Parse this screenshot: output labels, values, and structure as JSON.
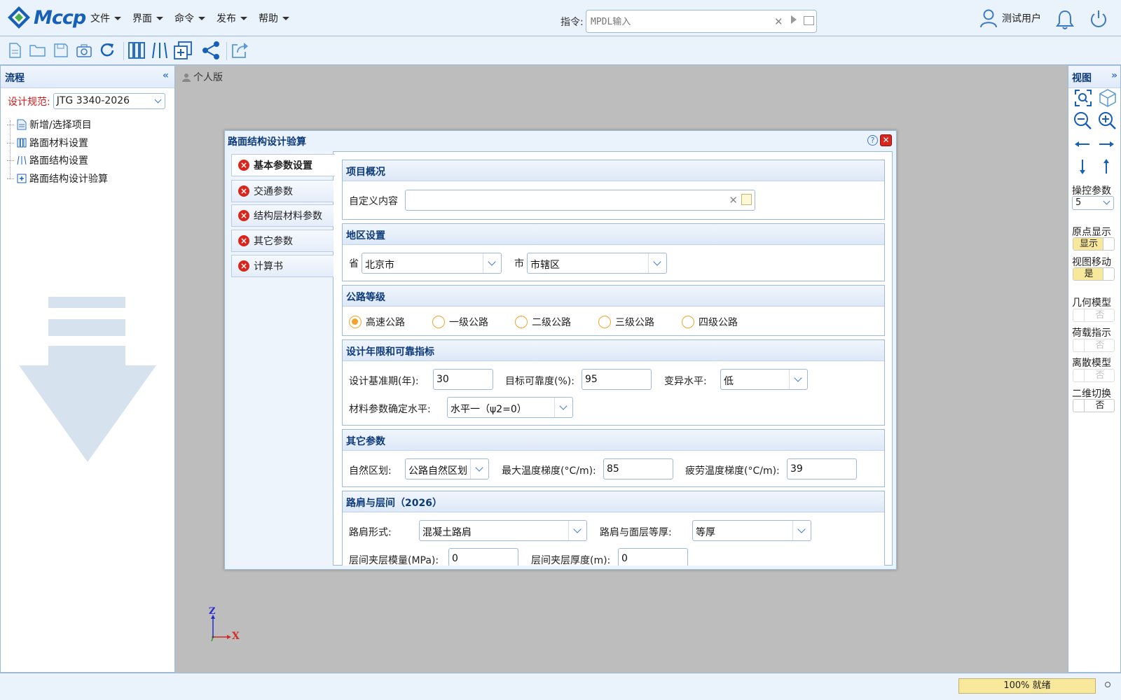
{
  "app": {
    "logo_text": "Mccp"
  },
  "menu": [
    {
      "label": "文件"
    },
    {
      "label": "界面"
    },
    {
      "label": "命令"
    },
    {
      "label": "发布"
    },
    {
      "label": "帮助"
    }
  ],
  "command": {
    "label": "指令:",
    "placeholder": "MPDL输入"
  },
  "user": {
    "name": "测试用户"
  },
  "left_panel": {
    "title": "流程",
    "spec_label": "设计规范:",
    "spec_value": "JTG 3340-2026",
    "tree": [
      {
        "label": "新增/选择项目"
      },
      {
        "label": "路面材料设置"
      },
      {
        "label": "路面结构设置"
      },
      {
        "label": "路面结构设计验算"
      }
    ]
  },
  "breadcrumb": "个人版",
  "dialog": {
    "title": "路面结构设计验算",
    "tabs": [
      {
        "label": "基本参数设置"
      },
      {
        "label": "交通参数"
      },
      {
        "label": "结构层材料参数"
      },
      {
        "label": "其它参数"
      },
      {
        "label": "计算书"
      }
    ],
    "sections": {
      "overview": {
        "title": "项目概况",
        "custom_label": "自定义内容",
        "custom_value": ""
      },
      "region": {
        "title": "地区设置",
        "province_label": "省",
        "province_value": "北京市",
        "city_label": "市",
        "city_value": "市辖区"
      },
      "grade": {
        "title": "公路等级",
        "options": [
          "高速公路",
          "一级公路",
          "二级公路",
          "三级公路",
          "四级公路"
        ],
        "selected": "高速公路"
      },
      "design": {
        "title": "设计年限和可靠指标",
        "period_label": "设计基准期(年):",
        "period_value": "30",
        "reliability_label": "目标可靠度(%):",
        "reliability_value": "95",
        "variation_label": "变异水平:",
        "variation_value": "低",
        "material_level_label": "材料参数确定水平:",
        "material_level_value": "水平一（ψ2=0）"
      },
      "other": {
        "title": "其它参数",
        "zone_label": "自然区划:",
        "zone_value": "公路自然区划",
        "max_temp_label": "最大温度梯度(°C/m):",
        "max_temp_value": "85",
        "fatigue_temp_label": "疲劳温度梯度(°C/m):",
        "fatigue_temp_value": "39"
      },
      "shoulder": {
        "title": "路肩与层间（2026）",
        "form_label": "路肩形式:",
        "form_value": "混凝土路肩",
        "equal_label": "路肩与面层等厚:",
        "equal_value": "等厚",
        "modulus_label": "层间夹层模量(MPa):",
        "modulus_value": "0",
        "thickness_label": "层间夹层厚度(m):",
        "thickness_value": "0"
      }
    }
  },
  "right_panel": {
    "title": "视图",
    "ctrl_label": "操控参数",
    "ctrl_value": "5",
    "toggles": [
      {
        "label": "原点显示",
        "value": "显示",
        "on": true
      },
      {
        "label": "视图移动",
        "value": "是",
        "on": true
      },
      {
        "label": "几何模型",
        "value": "否",
        "on": false
      },
      {
        "label": "荷载指示",
        "value": "否",
        "on": false
      },
      {
        "label": "离散模型",
        "value": "否",
        "on": false
      },
      {
        "label": "二维切换",
        "value": "否",
        "on": false
      }
    ]
  },
  "axes": {
    "z": "Z",
    "x": "X"
  },
  "status": {
    "progress_text": "100% 就绪",
    "progress_value": 1.0
  },
  "colors": {
    "accent": "#1760b8",
    "header_bg": "#eaf2fc",
    "error": "#d9261c",
    "radio": "#f0a52a",
    "toggle_on": "#f8e89b"
  }
}
